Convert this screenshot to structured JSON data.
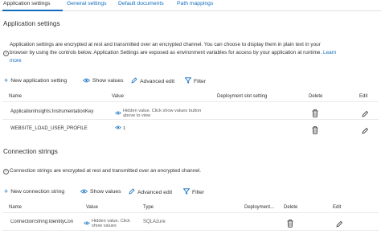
{
  "tabs": {
    "app_settings": "Application settings",
    "general_settings": "General settings",
    "default_documents": "Default documents",
    "path_mappings": "Path mappings"
  },
  "app_section": {
    "title": "Application settings",
    "info_line1": "Application settings are encrypted at rest and transmitted over an encrypted channel. You can choose to display them in plain text in your",
    "info_line2": "browser by using the controls below. Application Settings are exposed as environment variables for access by your application at runtime.",
    "learn_more_a": "Learn",
    "learn_more_b": "more",
    "new_button": "New application setting",
    "show_values": "Show values",
    "advanced_edit": "Advanced edit",
    "filter": "Filter",
    "columns": {
      "name": "Name",
      "value": "Value",
      "slot": "Deployment slot setting",
      "delete": "Delete",
      "edit": "Edit"
    },
    "rows": [
      {
        "name": "ApplicationInsights:InstrumentationKey",
        "value": "Hidden value. Click show values button above to view"
      },
      {
        "name": "WEBSITE_LOAD_USER_PROFILE",
        "value": "1"
      }
    ]
  },
  "conn_section": {
    "title": "Connection strings",
    "info": "Connection strings are encrypted at rest and transmitted over an encrypted channel.",
    "new_button": "New connection string",
    "show_values": "Show values",
    "advanced_edit": "Advanced edit",
    "filter": "Filter",
    "columns": {
      "name": "Name",
      "value": "Value",
      "type": "Type",
      "slot": "Deployment...",
      "delete": "Delete",
      "edit": "Edit"
    },
    "rows": [
      {
        "name": "ConnectionString:IdentityCon",
        "value": "Hidden value. Click show values",
        "type": "SQLAzure"
      }
    ]
  },
  "colors": {
    "accent": "#0f6cbd",
    "text": "#323130",
    "border": "#edebe9"
  }
}
